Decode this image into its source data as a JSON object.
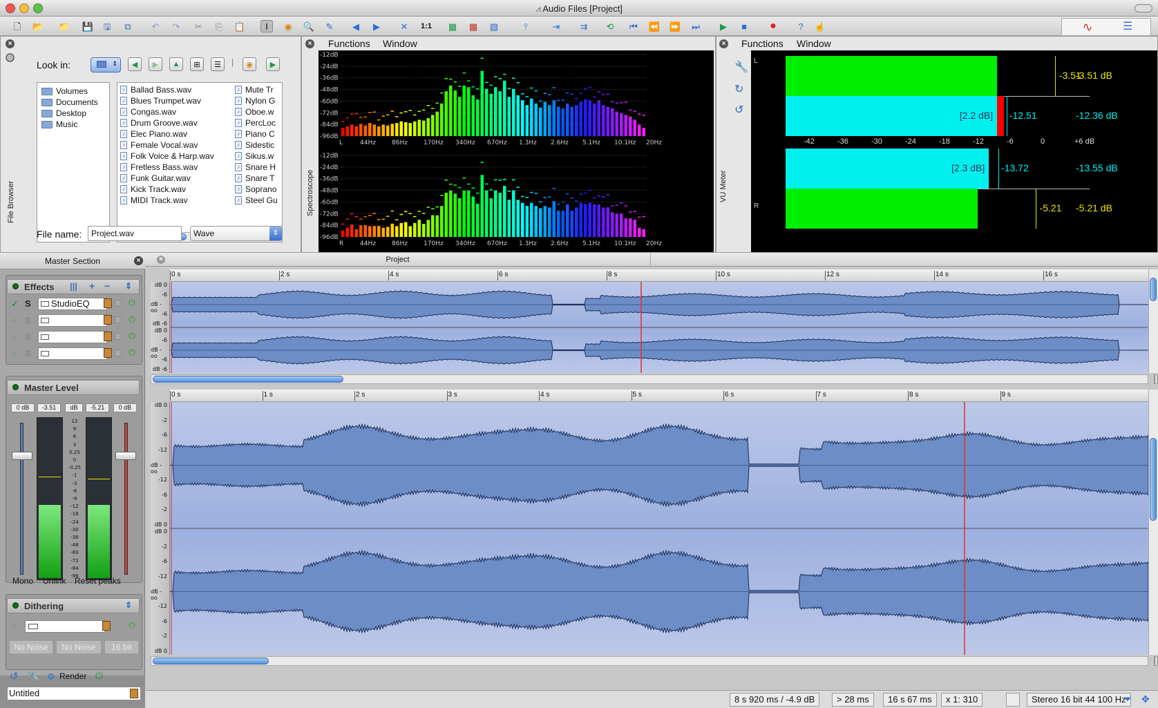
{
  "window": {
    "title": "Audio Files [Project]"
  },
  "toolbar": {
    "zoom_label": "1:1"
  },
  "file_browser": {
    "title": "File Browser",
    "look_in_label": "Look in:",
    "folders": [
      "Volumes",
      "Documents",
      "Desktop",
      "Music"
    ],
    "files_col1": [
      "Ballad Bass.wav",
      "Blues Trumpet.wav",
      "Congas.wav",
      "Drum Groove.wav",
      "Elec Piano.wav",
      "Female Vocal.wav",
      "Folk Voice & Harp.wav",
      "Fretless Bass.wav",
      "Funk Guitar.wav",
      "Kick Track.wav",
      "MIDI Track.wav"
    ],
    "files_col2": [
      "Mute Tr",
      "Nylon G",
      "Oboe.w",
      "PercLoc",
      "Piano C",
      "Sidestic",
      "Sikus.w",
      "Snare H",
      "Snare T",
      "Soprano",
      "Steel Gu"
    ],
    "file_name_label": "File name:",
    "file_name_value": "Project.wav",
    "format_value": "Wave"
  },
  "spectroscope": {
    "title": "Spectroscope",
    "menu": [
      "Functions",
      "Window"
    ],
    "y_ticks": [
      "-12dB",
      "-24dB",
      "-36dB",
      "-48dB",
      "-60dB",
      "-72dB",
      "-84dB",
      "-96dB"
    ],
    "x_ticks": [
      "44Hz",
      "86Hz",
      "170Hz",
      "340Hz",
      "670Hz",
      "1.3Hz",
      "2.6Hz",
      "5.1Hz",
      "10.1Hz",
      "20Hz"
    ],
    "channel_top": "L",
    "channel_bottom": "R"
  },
  "vu_meter": {
    "title": "VU Meter",
    "menu": [
      "Functions",
      "Window"
    ],
    "channel_l": "L",
    "channel_r": "R",
    "scale": [
      "-42",
      "-36",
      "-30",
      "-24",
      "-18",
      "-12",
      "-6",
      "0",
      "+6 dB"
    ],
    "rows": [
      {
        "bar": "peak",
        "level": 0.594,
        "readout": "-3.51",
        "db": "-3.51 dB"
      },
      {
        "bar": "rms",
        "level": 0.594,
        "bracket": "[2.2 dB]",
        "readout": "-12.51",
        "db": "-12.36 dB"
      },
      {
        "bar": "rms",
        "level": 0.571,
        "bracket": "[2.3 dB]",
        "readout": "-13.72",
        "db": "-13.55 dB"
      },
      {
        "bar": "peak",
        "level": 0.539,
        "readout": "-5.21",
        "db": "-5.21 dB"
      }
    ],
    "colors": {
      "peak": "#00ee00",
      "rms": "#00f0f0",
      "over": "#ff0000"
    }
  },
  "master": {
    "title": "Master Section",
    "effects_label": "Effects",
    "effect_slots": [
      "StudioEQ",
      "",
      "",
      ""
    ],
    "solo_label": "S",
    "master_level_label": "Master Level",
    "level_boxes": [
      "0 dB",
      "-3.51",
      "dB",
      "-5.21",
      "0 dB"
    ],
    "meter_scale": [
      "12",
      "9",
      "6",
      "3",
      "0.25",
      "0",
      "-0.25",
      "-1",
      "-3",
      "-6",
      "-9",
      "-12",
      "-18",
      "-24",
      "-30",
      "-36",
      "-48",
      "-60",
      "-72",
      "-84",
      "-96"
    ],
    "mono_label": "Mono",
    "unlink_label": "Unlink",
    "reset_label": "Reset peaks",
    "dithering_label": "Dithering",
    "dither_buttons": [
      "No Noise",
      "No Noise",
      "16 bit"
    ],
    "render_label": "Render",
    "preset_value": "Untitled"
  },
  "project": {
    "tab_label": "Project",
    "overview_ruler": [
      "0 s",
      "2 s",
      "4 s",
      "6 s",
      "8 s",
      "10 s",
      "12 s",
      "14 s",
      "16 s"
    ],
    "detail_ruler": [
      "0 s",
      "1 s",
      "2 s",
      "3 s",
      "4 s",
      "5 s",
      "6 s",
      "7 s",
      "8 s",
      "9 s"
    ],
    "db_small": [
      "dB 0",
      "-6",
      "dB -oo",
      "-6",
      "dB -6"
    ],
    "db_large": [
      "dB 0",
      "-2",
      "-6",
      "-12",
      "dB -oo",
      "-12",
      "-6",
      "-2",
      "dB 0"
    ]
  },
  "status": {
    "cursor": "8 s 920 ms / -4.9 dB",
    "selection": "> 28 ms",
    "length": "16 s 67 ms",
    "zoom": "x 1: 310",
    "format": "Stereo 16 bit 44 100 Hz"
  }
}
